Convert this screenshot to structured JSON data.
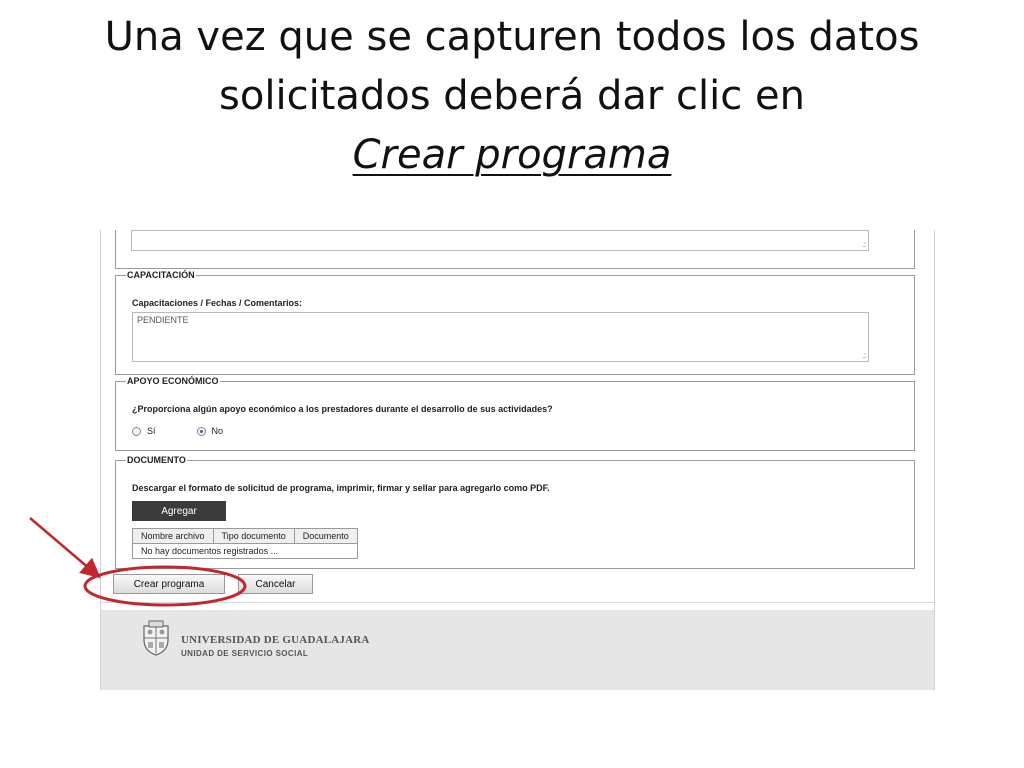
{
  "slide": {
    "title_line1": "Una vez que se capturen todos los datos",
    "title_line2": "solicitados deberá dar clic en",
    "title_line3": "Crear programa"
  },
  "form": {
    "capacitacion": {
      "legend": "CAPACITACIÓN",
      "label": "Capacitaciones / Fechas / Comentarios:",
      "value": "PENDIENTE"
    },
    "apoyo": {
      "legend": "APOYO ECONÓMICO",
      "question": "¿Proporciona algún apoyo económico a los prestadores durante el desarrollo de sus actividades?",
      "option_yes": "Sí",
      "option_no": "No",
      "selected": "No"
    },
    "documento": {
      "legend": "DOCUMENTO",
      "instructions": "Descargar el formato de solicitud de programa, imprimir, firmar y sellar para agregarlo como PDF.",
      "add_button": "Agregar",
      "columns": [
        "Nombre archivo",
        "Tipo documento",
        "Documento"
      ],
      "empty_message": "No hay documentos registrados ..."
    },
    "buttons": {
      "create": "Crear programa",
      "cancel": "Cancelar"
    }
  },
  "footer": {
    "university": "UNIVERSIDAD DE GUADALAJARA",
    "unit": "UNIDAD DE SERVICIO SOCIAL"
  },
  "annotation": {
    "color": "#c0282d"
  }
}
